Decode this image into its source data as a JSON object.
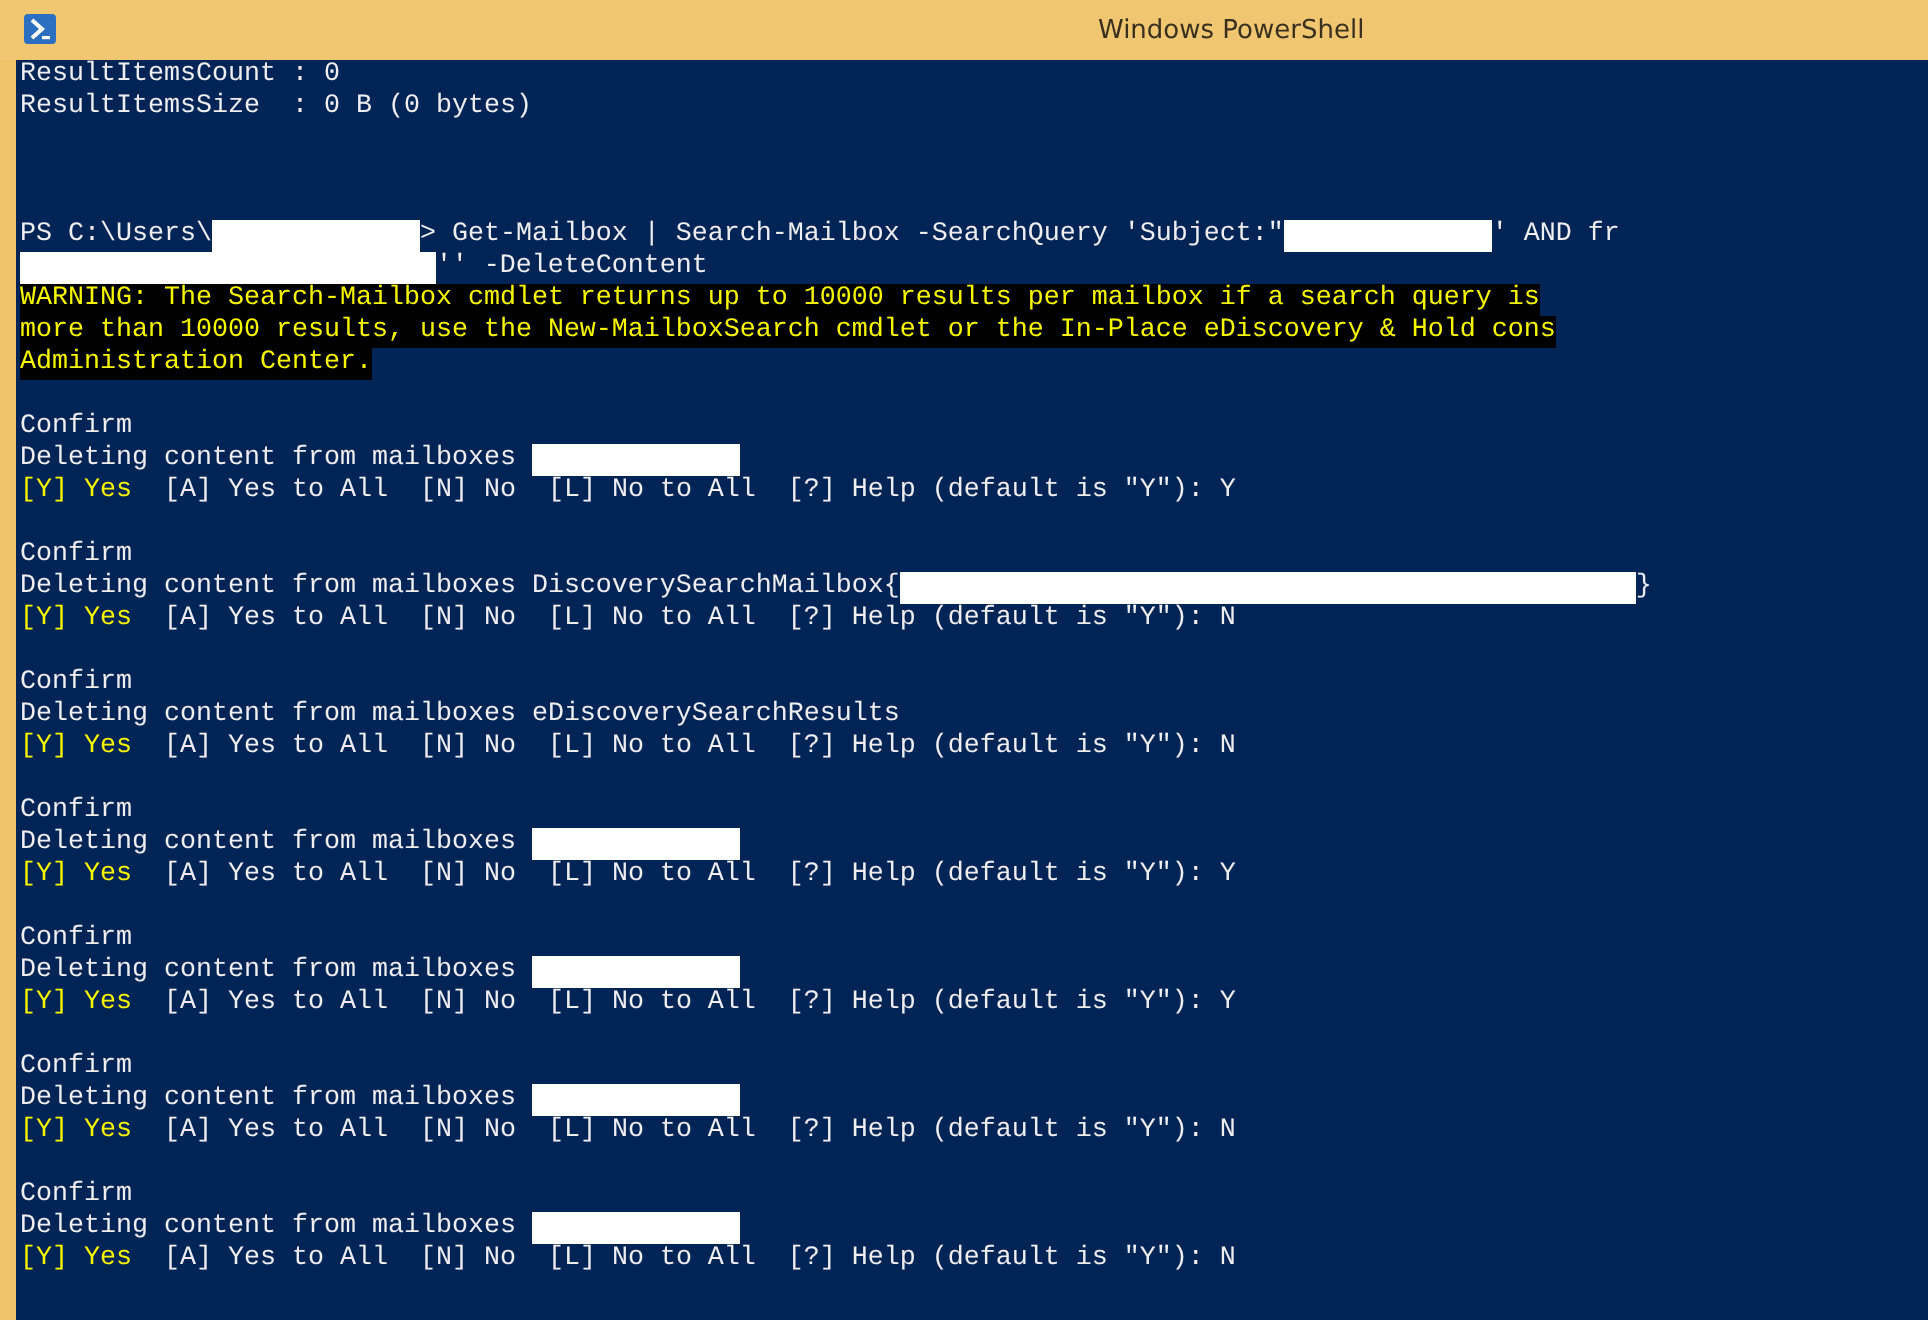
{
  "window": {
    "title": "Windows PowerShell"
  },
  "lines": [
    {
      "kind": "output",
      "segments": [
        {
          "kind": "text",
          "text": "ResultItemsCount : 0"
        }
      ]
    },
    {
      "kind": "output",
      "segments": [
        {
          "kind": "text",
          "text": "ResultItemsSize  : 0 B (0 bytes)"
        }
      ]
    },
    {
      "kind": "blank"
    },
    {
      "kind": "blank"
    },
    {
      "kind": "blank"
    },
    {
      "kind": "output",
      "segments": [
        {
          "kind": "text",
          "text": "PS C:\\Users\\"
        },
        {
          "kind": "redacted"
        },
        {
          "kind": "text",
          "text": "> Get-Mailbox | Search-Mailbox -SearchQuery 'Subject:\""
        },
        {
          "kind": "redacted"
        },
        {
          "kind": "text",
          "text": "' AND fr"
        }
      ]
    },
    {
      "kind": "output",
      "segments": [
        {
          "kind": "redacted_wide"
        },
        {
          "kind": "text",
          "text": "'' -DeleteContent"
        }
      ]
    },
    {
      "kind": "warning",
      "segments": [
        {
          "kind": "text",
          "text": "WARNING: The Search-Mailbox cmdlet returns up to 10000 results per mailbox if a search query is"
        }
      ]
    },
    {
      "kind": "warning",
      "segments": [
        {
          "kind": "text",
          "text": "more than 10000 results, use the New-MailboxSearch cmdlet or the In-Place eDiscovery & Hold cons"
        }
      ]
    },
    {
      "kind": "warning",
      "segments": [
        {
          "kind": "text",
          "text": "Administration Center."
        }
      ]
    },
    {
      "kind": "blank"
    },
    {
      "kind": "output",
      "segments": [
        {
          "kind": "text",
          "text": "Confirm"
        }
      ]
    },
    {
      "kind": "output",
      "segments": [
        {
          "kind": "text",
          "text": "Deleting content from mailboxes "
        },
        {
          "kind": "redacted"
        }
      ]
    },
    {
      "kind": "output",
      "segments": [
        {
          "kind": "highlight",
          "text": "[Y] Yes"
        },
        {
          "kind": "text",
          "text": "  [A] Yes to All  [N] No  [L] No to All  [?] Help (default is \"Y\"): Y"
        }
      ]
    },
    {
      "kind": "blank"
    },
    {
      "kind": "output",
      "segments": [
        {
          "kind": "text",
          "text": "Confirm"
        }
      ]
    },
    {
      "kind": "output",
      "segments": [
        {
          "kind": "text",
          "text": "Deleting content from mailboxes DiscoverySearchMailbox{"
        },
        {
          "kind": "redacted_huge"
        },
        {
          "kind": "text",
          "text": "}"
        }
      ]
    },
    {
      "kind": "output",
      "segments": [
        {
          "kind": "highlight",
          "text": "[Y] Yes"
        },
        {
          "kind": "text",
          "text": "  [A] Yes to All  [N] No  [L] No to All  [?] Help (default is \"Y\"): N"
        }
      ]
    },
    {
      "kind": "blank"
    },
    {
      "kind": "output",
      "segments": [
        {
          "kind": "text",
          "text": "Confirm"
        }
      ]
    },
    {
      "kind": "output",
      "segments": [
        {
          "kind": "text",
          "text": "Deleting content from mailboxes eDiscoverySearchResults"
        }
      ]
    },
    {
      "kind": "output",
      "segments": [
        {
          "kind": "highlight",
          "text": "[Y] Yes"
        },
        {
          "kind": "text",
          "text": "  [A] Yes to All  [N] No  [L] No to All  [?] Help (default is \"Y\"): N"
        }
      ]
    },
    {
      "kind": "blank"
    },
    {
      "kind": "output",
      "segments": [
        {
          "kind": "text",
          "text": "Confirm"
        }
      ]
    },
    {
      "kind": "output",
      "segments": [
        {
          "kind": "text",
          "text": "Deleting content from mailboxes "
        },
        {
          "kind": "redacted"
        }
      ]
    },
    {
      "kind": "output",
      "segments": [
        {
          "kind": "highlight",
          "text": "[Y] Yes"
        },
        {
          "kind": "text",
          "text": "  [A] Yes to All  [N] No  [L] No to All  [?] Help (default is \"Y\"): Y"
        }
      ]
    },
    {
      "kind": "blank"
    },
    {
      "kind": "output",
      "segments": [
        {
          "kind": "text",
          "text": "Confirm"
        }
      ]
    },
    {
      "kind": "output",
      "segments": [
        {
          "kind": "text",
          "text": "Deleting content from mailboxes "
        },
        {
          "kind": "redacted"
        }
      ]
    },
    {
      "kind": "output",
      "segments": [
        {
          "kind": "highlight",
          "text": "[Y] Yes"
        },
        {
          "kind": "text",
          "text": "  [A] Yes to All  [N] No  [L] No to All  [?] Help (default is \"Y\"): Y"
        }
      ]
    },
    {
      "kind": "blank"
    },
    {
      "kind": "output",
      "segments": [
        {
          "kind": "text",
          "text": "Confirm"
        }
      ]
    },
    {
      "kind": "output",
      "segments": [
        {
          "kind": "text",
          "text": "Deleting content from mailboxes "
        },
        {
          "kind": "redacted"
        }
      ]
    },
    {
      "kind": "output",
      "segments": [
        {
          "kind": "highlight",
          "text": "[Y] Yes"
        },
        {
          "kind": "text",
          "text": "  [A] Yes to All  [N] No  [L] No to All  [?] Help (default is \"Y\"): N"
        }
      ]
    },
    {
      "kind": "blank"
    },
    {
      "kind": "output",
      "segments": [
        {
          "kind": "text",
          "text": "Confirm"
        }
      ]
    },
    {
      "kind": "output",
      "segments": [
        {
          "kind": "text",
          "text": "Deleting content from mailboxes "
        },
        {
          "kind": "redacted"
        }
      ]
    },
    {
      "kind": "output",
      "segments": [
        {
          "kind": "highlight",
          "text": "[Y] Yes"
        },
        {
          "kind": "text",
          "text": "  [A] Yes to All  [N] No  [L] No to All  [?] Help (default is \"Y\"): N"
        }
      ]
    }
  ]
}
